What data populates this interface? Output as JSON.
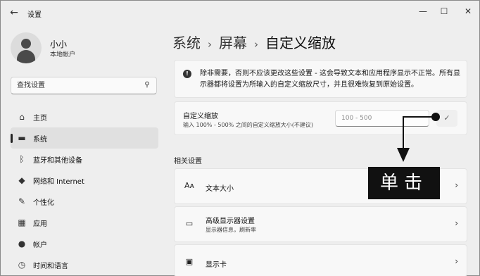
{
  "window": {
    "title": "设置",
    "back_icon": "←",
    "minimize_icon": "—",
    "maximize_icon": "☐",
    "close_icon": "✕"
  },
  "user": {
    "name": "小小",
    "account_type": "本地帐户"
  },
  "search": {
    "placeholder": "查找设置",
    "icon": "⚲"
  },
  "sidebar": {
    "items": [
      {
        "label": "主页",
        "icon": "⌂",
        "active": false
      },
      {
        "label": "系统",
        "icon": "▬",
        "active": true
      },
      {
        "label": "蓝牙和其他设备",
        "icon": "ᛒ",
        "active": false
      },
      {
        "label": "网络和 Internet",
        "icon": "◆",
        "active": false
      },
      {
        "label": "个性化",
        "icon": "✎",
        "active": false
      },
      {
        "label": "应用",
        "icon": "▦",
        "active": false
      },
      {
        "label": "帐户",
        "icon": "●",
        "active": false
      },
      {
        "label": "时间和语言",
        "icon": "◷",
        "active": false
      }
    ]
  },
  "breadcrumb": {
    "items": [
      "系统",
      "屏幕",
      "自定义缩放"
    ],
    "separator": "›"
  },
  "warning": {
    "icon": "!",
    "text": "除非需要，否则不应该更改这些设置 - 这会导致文本和应用程序显示不正常。所有显示器都将设置为所输入的自定义缩放尺寸，并且很难恢复到原始设置。"
  },
  "custom_scaling": {
    "title": "自定义缩放",
    "description": "输入 100% - 500% 之间的自定义缩放大小(不建议)",
    "input_placeholder": "100 - 500",
    "check_icon": "✓"
  },
  "related": {
    "section_title": "相关设置",
    "items": [
      {
        "label": "文本大小",
        "sub": "",
        "icon": "Aᴀ",
        "chevron": "›"
      },
      {
        "label": "高级显示器设置",
        "sub": "显示器信息，刷新率",
        "icon": "▭",
        "chevron": "›"
      },
      {
        "label": "显示卡",
        "sub": "",
        "icon": "▣",
        "chevron": "›"
      }
    ]
  },
  "annotation": {
    "label": "单击"
  },
  "colors": {
    "background": "#eeeeee",
    "card": "#f8f8f8",
    "annotation": "#111111"
  }
}
